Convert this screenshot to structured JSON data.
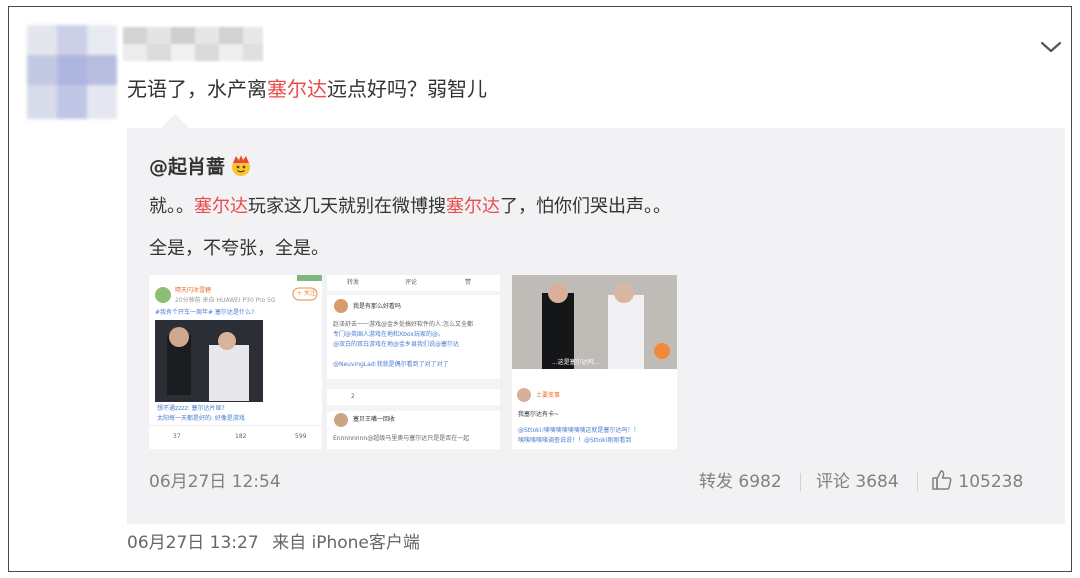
{
  "post": {
    "text_before": "无语了，水产离",
    "text_highlight": "塞尔达",
    "text_after": "远点好吗？弱智儿",
    "time": "06月27日 13:27",
    "source": "来自 iPhone客户端"
  },
  "repost": {
    "author": "@起肖蔷",
    "badge_icon": "crown-face-icon",
    "line1": {
      "a": "就。。",
      "b": "塞尔达",
      "c": "玩家这几天就别在微博搜",
      "d": "塞尔达",
      "e": "了，怕你们哭出声。。"
    },
    "line2": "全是，不夸张，全是。",
    "time": "06月27日 12:54",
    "repost_label": "转发 6982",
    "comment_label": "评论 3684",
    "like_count": "105238"
  },
  "thumbs": {
    "t1": {
      "user": "晴天闪冰雪碧",
      "sub": "20分钟前 来自 HUAWEI P30 Pro 5G",
      "follow": "+ 关注",
      "tag": "#我有个开车一周年# 塞尔达是什么?",
      "reply1": "想不通zzzz: 塞尔达片姬?",
      "reply2": "太阳每一天都是好的: 好像是游戏",
      "c1": "37",
      "c2": "182",
      "c3": "599"
    },
    "t2": {
      "top_r": "转发",
      "top_c": "评论",
      "top_l": "赞",
      "user": "我是有那么好看吗",
      "l1": "赵泽舒去一一游戏@金乡处搞好软件的人:怎么又全都",
      "l2": "专门@英国人游戏在地和Xbox玩家的@。",
      "l3": "@双白的双白游戏在地@金乡县我们说@塞尔达",
      "l4": "@NeuvingLad:我就是偶尔看到了对了对了",
      "c1": "2",
      "user2": "塞贝王嘴一回收",
      "l5": "Ennnnnnnn@超级马里奥与塞尔达只是是否在一起"
    },
    "t3": {
      "caption": "...这是塞尔达吗...",
      "user": "土要变事",
      "l1": "我塞尔达有卡~",
      "l2": "@Sttoki:咦咦咦咦咦咦咦这就是塞尔达吗！！",
      "l3": "咦咦咦咦咦调查说说！！@Sttoki刚刚看到"
    }
  },
  "colors": {
    "highlight": "#eb4c4c",
    "muted": "#808080",
    "repost_bg": "#f2f2f5"
  }
}
